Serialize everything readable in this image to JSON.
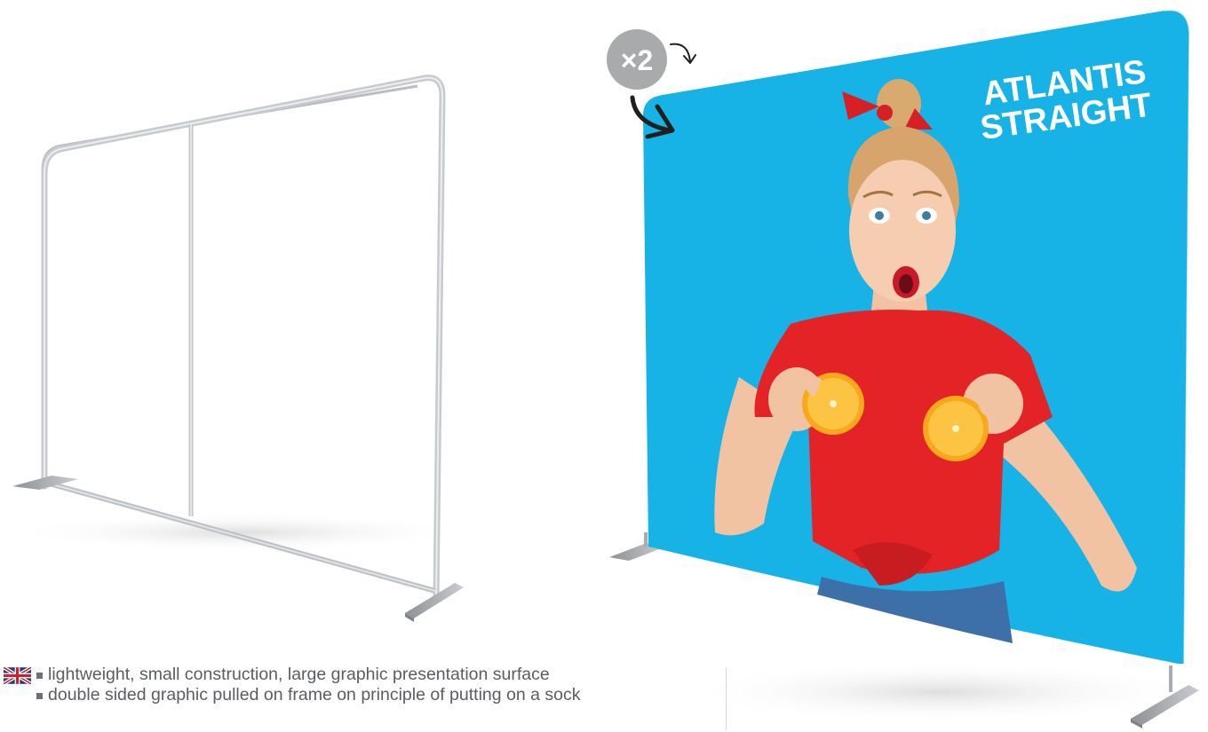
{
  "product": {
    "name": "ATLANTIS STRAIGHT",
    "name_lines": [
      "ATLANTIS",
      "STRAIGHT"
    ],
    "graphic_multiplier": "×2"
  },
  "features": {
    "language_flag": "uk-flag-icon",
    "items": [
      "lightweight, small construction, large graphic presentation surface",
      "double sided graphic pulled on frame on principle of putting on a sock"
    ]
  },
  "colors": {
    "graphic_background": "#17b3e6",
    "frame_silver": "#c9ccd0",
    "badge_grey": "#a9aaab",
    "shirt_red": "#e42326",
    "orange": "#f7a81b",
    "text_grey": "#5a5d63"
  },
  "icons": [
    "uk-flag-icon",
    "bullet-square-icon",
    "curved-arrow-icon",
    "multiplier-badge-icon"
  ]
}
